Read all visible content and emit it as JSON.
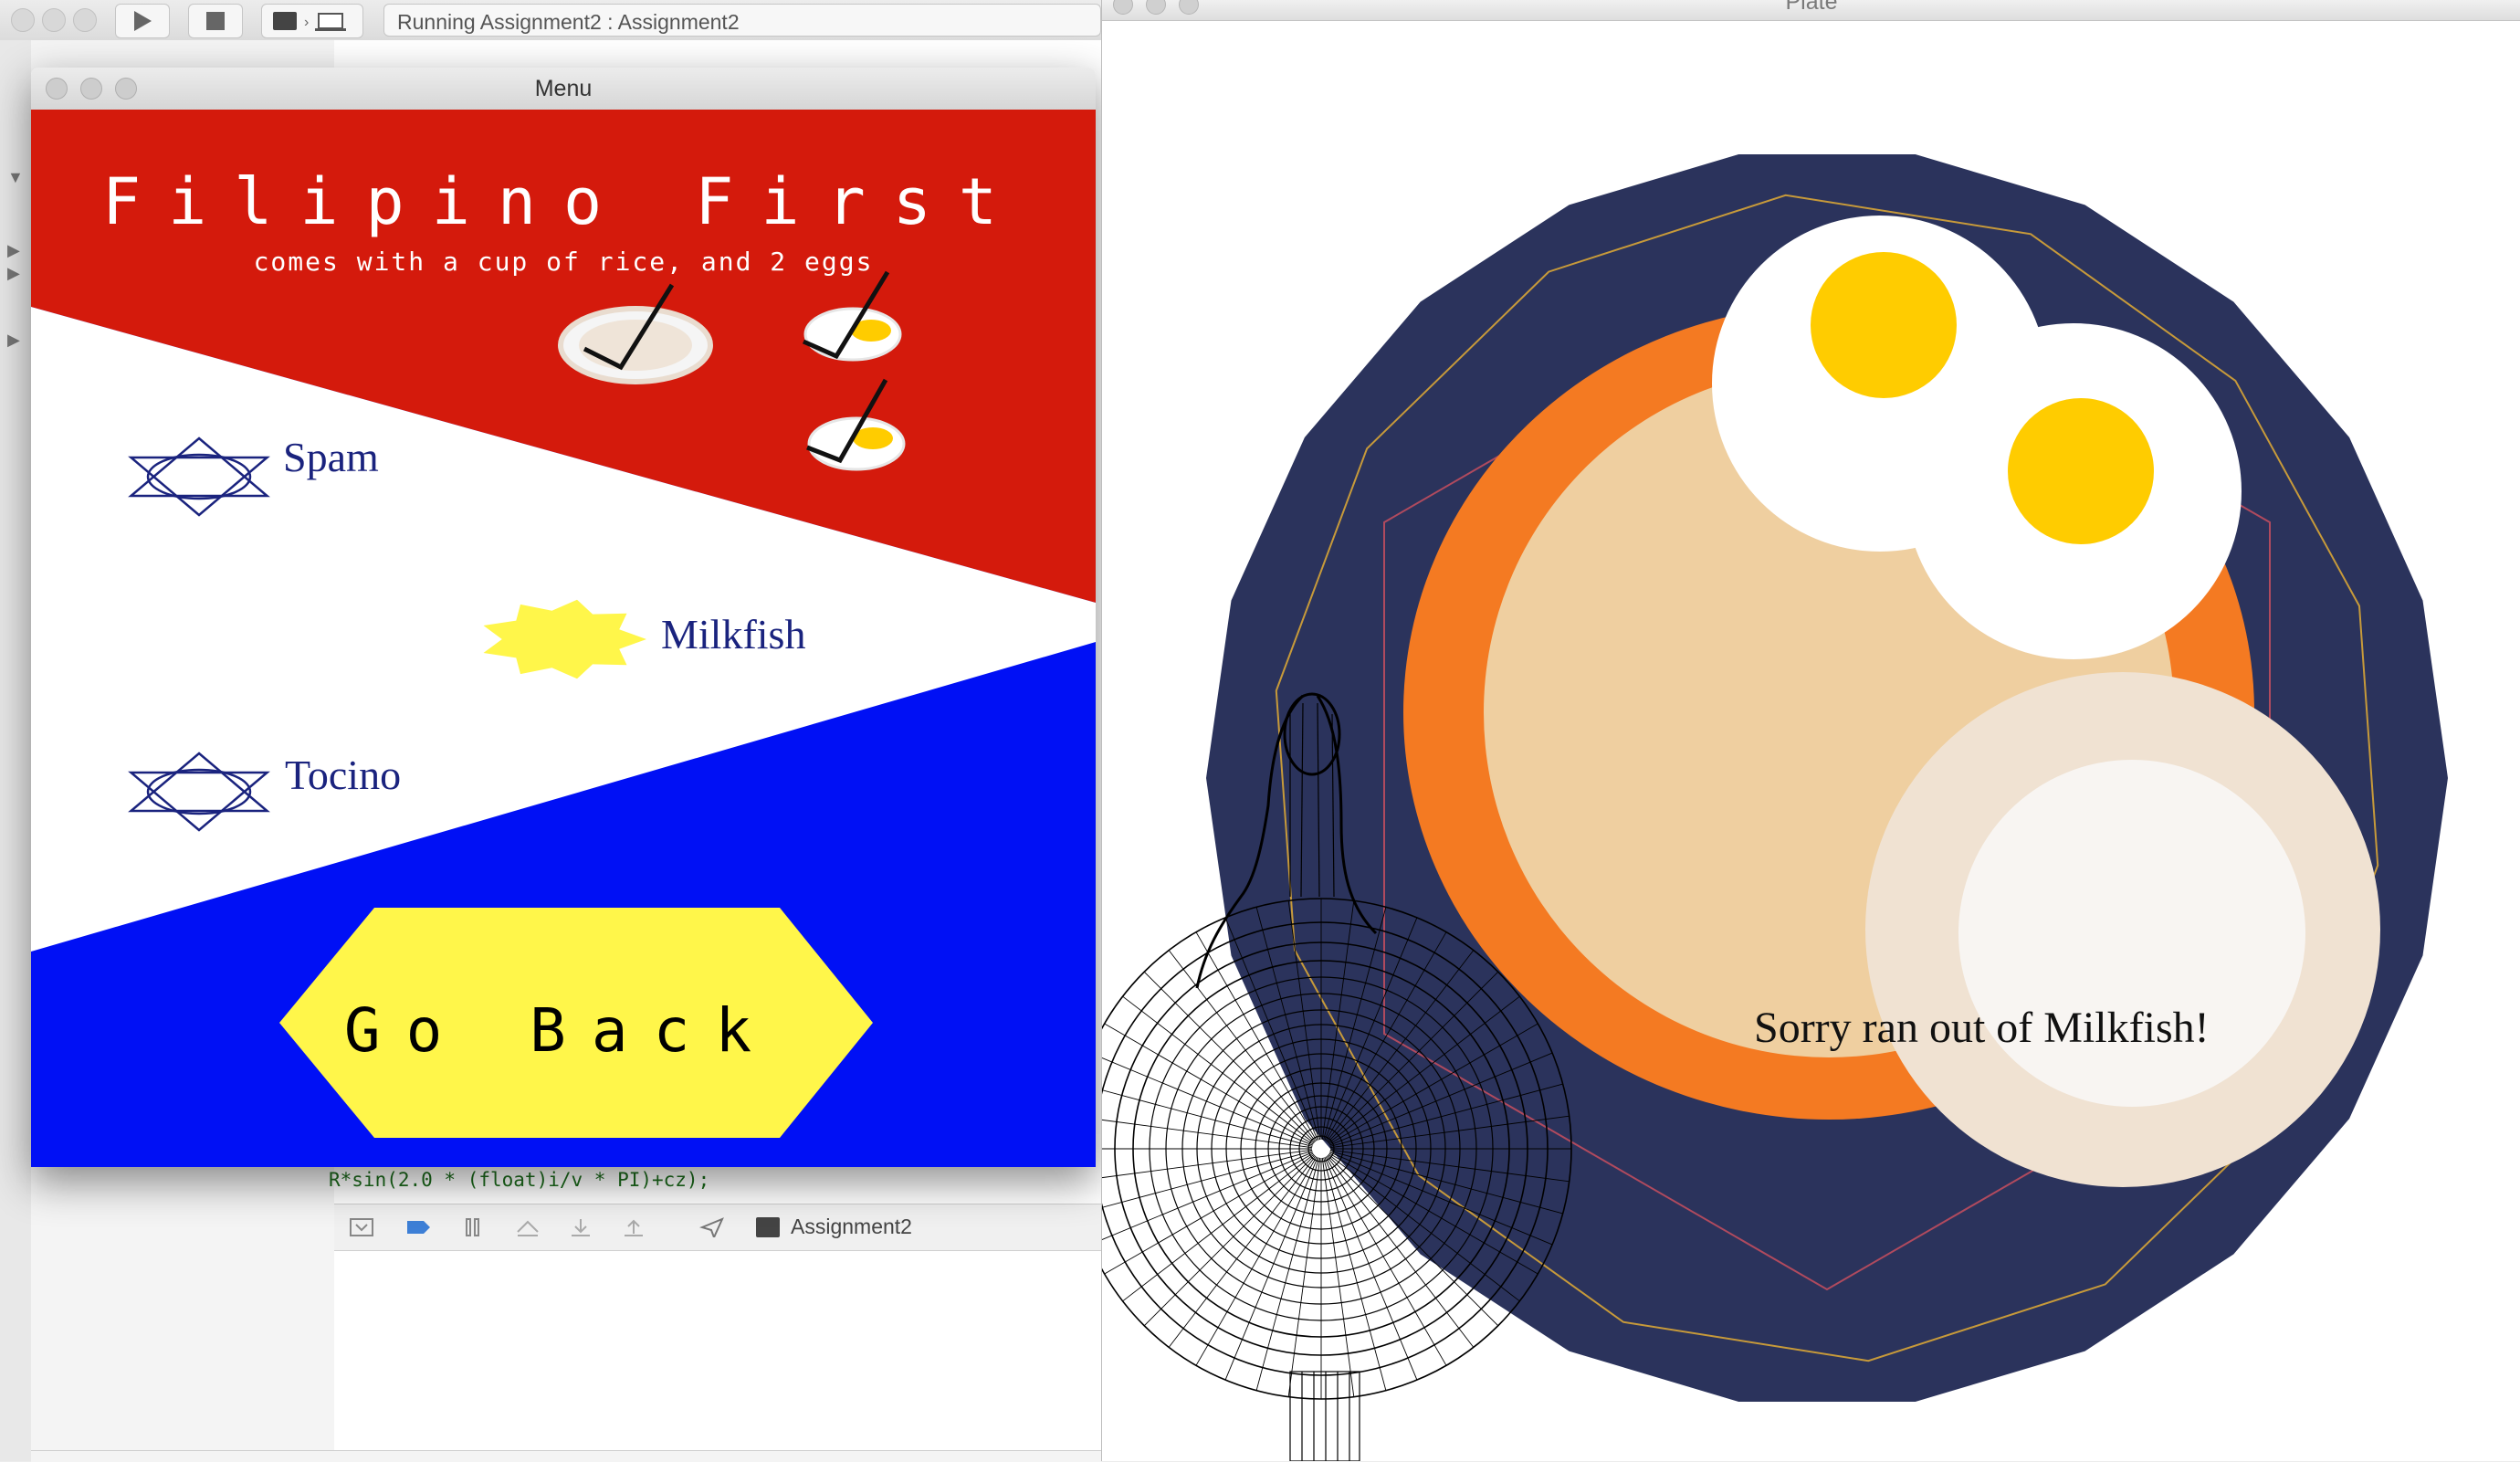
{
  "xcode": {
    "activity_text": "Running Assignment2 : Assignment2",
    "code_fragment": "R*sin(2.0 * (float)i/v * PI)+cz);",
    "debug_process_label": "Assignment2"
  },
  "menu_window": {
    "title": "Menu",
    "heading": "Filipino First",
    "subheading": "comes with a cup of rice, and 2 eggs",
    "items": [
      {
        "label": "Spam",
        "state": "unselected",
        "icon": "star-outline-icon"
      },
      {
        "label": "Milkfish",
        "state": "selected",
        "icon": "star-filled-icon"
      },
      {
        "label": "Tocino",
        "state": "unselected",
        "icon": "star-outline-icon"
      }
    ],
    "go_back_label": "Go Back",
    "colors": {
      "red": "#d41a0c",
      "white": "#ffffff",
      "blue": "#0010f5",
      "yellow": "#fff64a",
      "navy": "#1a237e"
    }
  },
  "plate_window": {
    "title": "Plate",
    "message": "Sorry ran out of Milkfish!",
    "colors": {
      "plate": "#2b335c",
      "orange": "#f47a22",
      "rice": "#efcfa0",
      "egg_white": "#ffffff",
      "yolk": "#ffcc00",
      "side_dish": "#f0e2d2",
      "side_inner": "#f8f5f2"
    }
  }
}
